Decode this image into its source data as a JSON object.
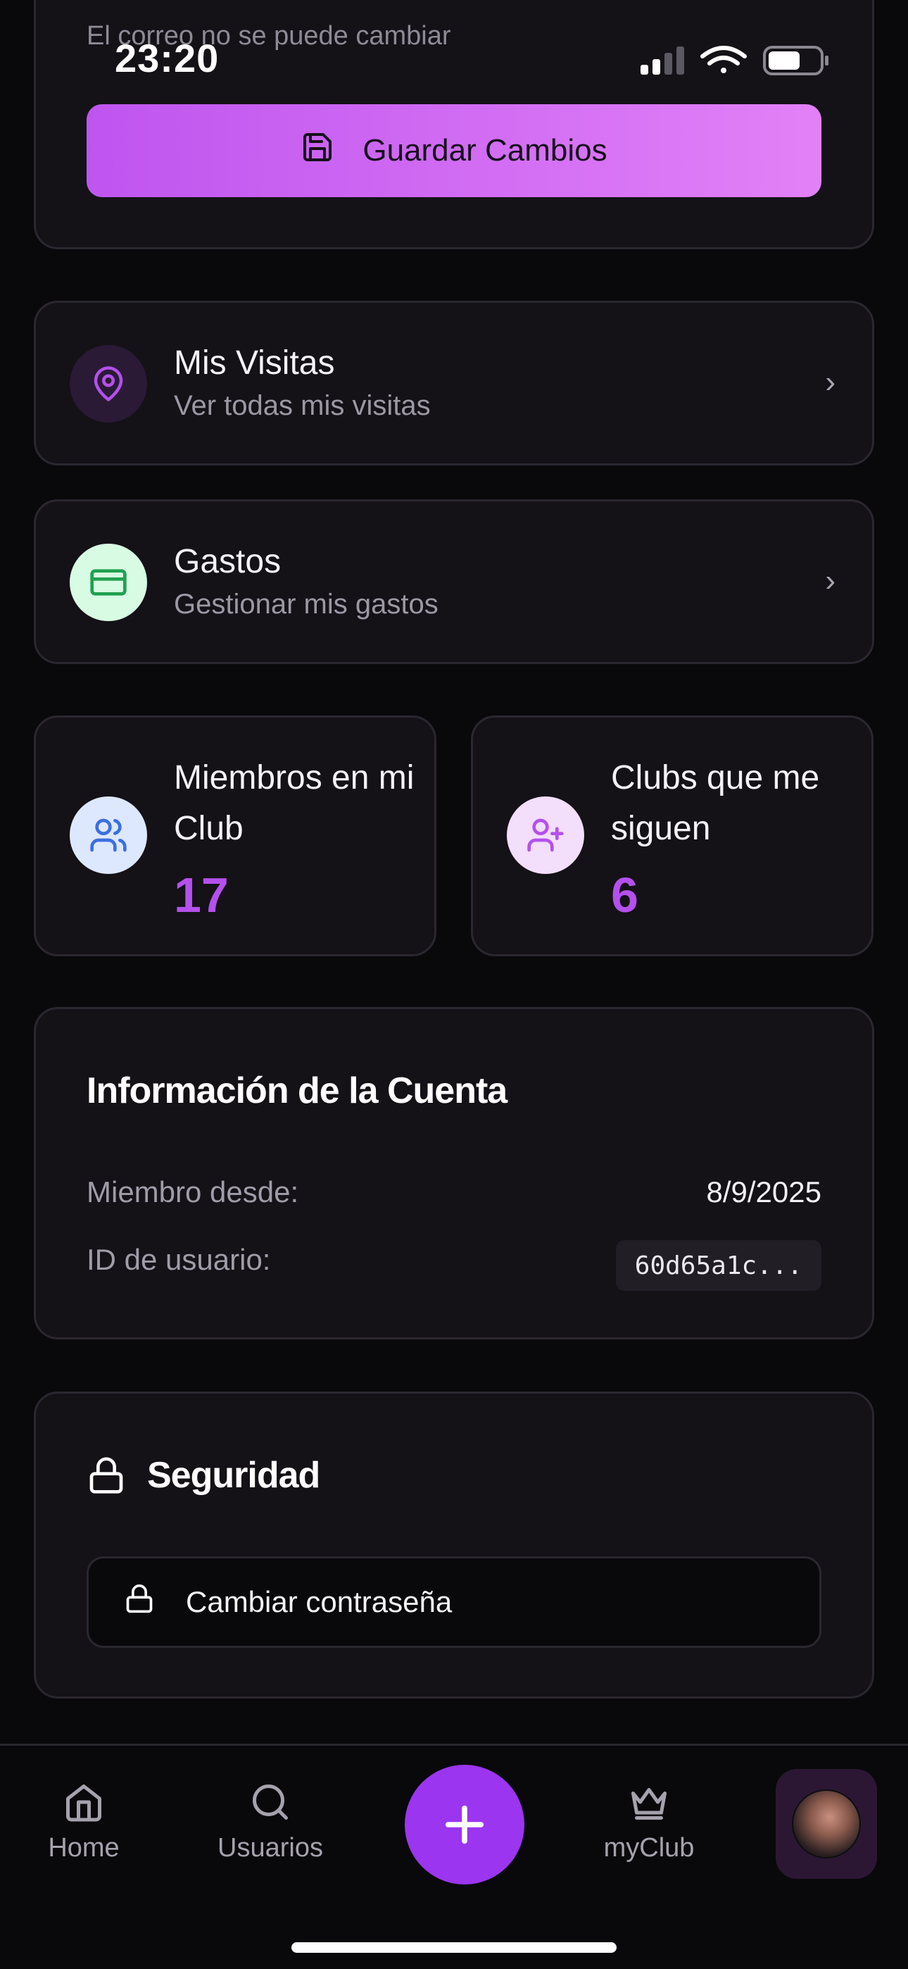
{
  "status_bar": {
    "time": "23:20"
  },
  "profile_form": {
    "email_note": "El correo no se puede cambiar",
    "save_label": "Guardar Cambios"
  },
  "nav_rows": [
    {
      "title": "Mis Visitas",
      "subtitle": "Ver todas mis visitas",
      "icon": "map-pin-icon"
    },
    {
      "title": "Gastos",
      "subtitle": "Gestionar mis gastos",
      "icon": "credit-card-icon"
    }
  ],
  "stats": [
    {
      "label": "Miembros en mi Club",
      "value": "17",
      "icon": "users-icon"
    },
    {
      "label": "Clubs que me siguen",
      "value": "6",
      "icon": "user-plus-icon"
    }
  ],
  "account_info": {
    "title": "Información de la Cuenta",
    "member_since_label": "Miembro desde:",
    "member_since_value": "8/9/2025",
    "user_id_label": "ID de usuario:",
    "user_id_value": "60d65a1c..."
  },
  "security": {
    "title": "Seguridad",
    "change_password_label": "Cambiar contraseña"
  },
  "bottom_nav": {
    "tabs": [
      {
        "label": "Home",
        "icon": "home-icon"
      },
      {
        "label": "Usuarios",
        "icon": "search-icon"
      },
      {
        "label": "myClub",
        "icon": "crown-icon"
      }
    ],
    "fab_icon": "plus-icon"
  },
  "colors": {
    "background": "#09080b",
    "card": "#141117",
    "accent": "#b450ec",
    "fab": "#9b35ef",
    "save_gradient_start": "#bf55ef",
    "save_gradient_end": "#e281f7"
  }
}
